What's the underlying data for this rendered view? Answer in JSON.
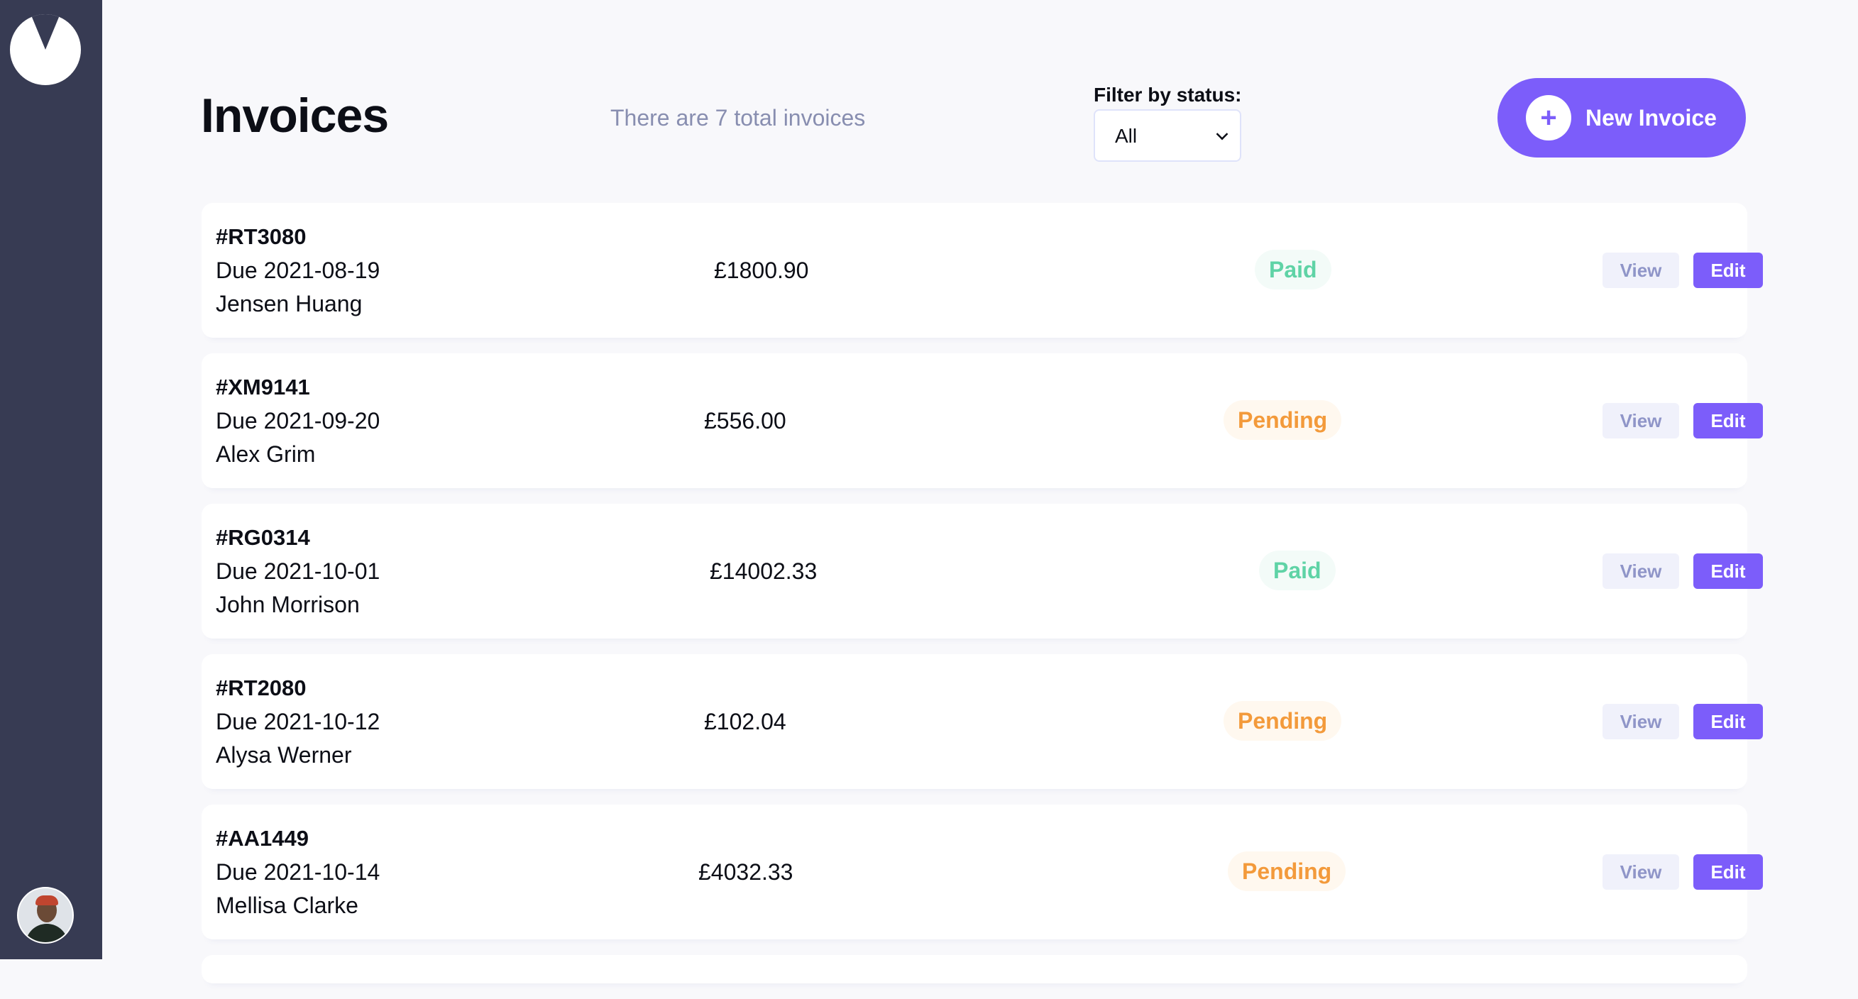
{
  "header": {
    "title": "Invoices",
    "subtitle": "There are 7 total invoices",
    "filter_label": "Filter by status:",
    "filter_value": "All",
    "new_invoice_label": "New Invoice",
    "new_invoice_icon": "+"
  },
  "sidebar": {
    "logo": "logo-icon",
    "avatar": "user-avatar"
  },
  "invoices": [
    {
      "id": "#RT3080",
      "due": "Due 2021-08-19",
      "client": "Jensen Huang",
      "amount": "£1800.90",
      "status": "Paid",
      "view": "View",
      "edit": "Edit"
    },
    {
      "id": "#XM9141",
      "due": "Due 2021-09-20",
      "client": "Alex Grim",
      "amount": "£556.00",
      "status": "Pending",
      "view": "View",
      "edit": "Edit"
    },
    {
      "id": "#RG0314",
      "due": "Due 2021-10-01",
      "client": "John Morrison",
      "amount": "£14002.33",
      "status": "Paid",
      "view": "View",
      "edit": "Edit"
    },
    {
      "id": "#RT2080",
      "due": "Due 2021-10-12",
      "client": "Alysa Werner",
      "amount": "£102.04",
      "status": "Pending",
      "view": "View",
      "edit": "Edit"
    },
    {
      "id": "#AA1449",
      "due": "Due 2021-10-14",
      "client": "Mellisa Clarke",
      "amount": "£4032.33",
      "status": "Pending",
      "view": "View",
      "edit": "Edit"
    }
  ],
  "colors": {
    "sidebar": "#373b53",
    "accent": "#7c5dfa",
    "paid": "#33d69f",
    "pending": "#ff8f00"
  }
}
